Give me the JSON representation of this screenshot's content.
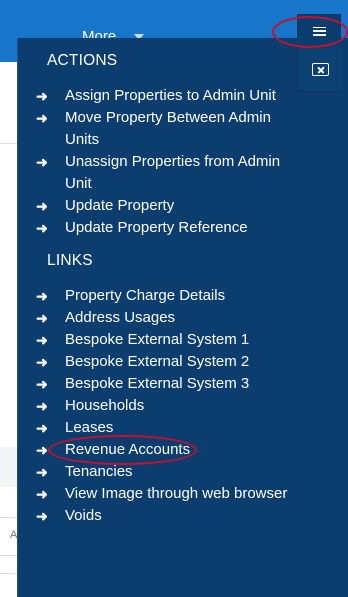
{
  "topbar": {
    "more_label": "More"
  },
  "menu_button": {
    "icon": "hamburger-menu-icon"
  },
  "panel": {
    "close_icon": "close-icon",
    "actions": {
      "title": "ACTIONS",
      "items": [
        {
          "label": "Assign Properties to Admin Unit"
        },
        {
          "label": "Move Property Between Admin Units"
        },
        {
          "label": "Unassign Properties from Admin Unit"
        },
        {
          "label": "Update Property"
        },
        {
          "label": "Update Property Reference"
        }
      ]
    },
    "links": {
      "title": "LINKS",
      "items": [
        {
          "label": "Property Charge Details"
        },
        {
          "label": "Address Usages"
        },
        {
          "label": "Bespoke External System 1"
        },
        {
          "label": "Bespoke External System 2"
        },
        {
          "label": "Bespoke External System 3"
        },
        {
          "label": "Households"
        },
        {
          "label": "Leases"
        },
        {
          "label": "Revenue Accounts"
        },
        {
          "label": "Tenancies"
        },
        {
          "label": "View Image through web browser"
        },
        {
          "label": "Voids"
        }
      ]
    },
    "arrow_glyph": "➜"
  },
  "background": {
    "cut_off_letter": "A"
  },
  "colors": {
    "topbar": "#1776c9",
    "panel": "#0b3d6e",
    "highlight_circle": "#c8102e"
  }
}
